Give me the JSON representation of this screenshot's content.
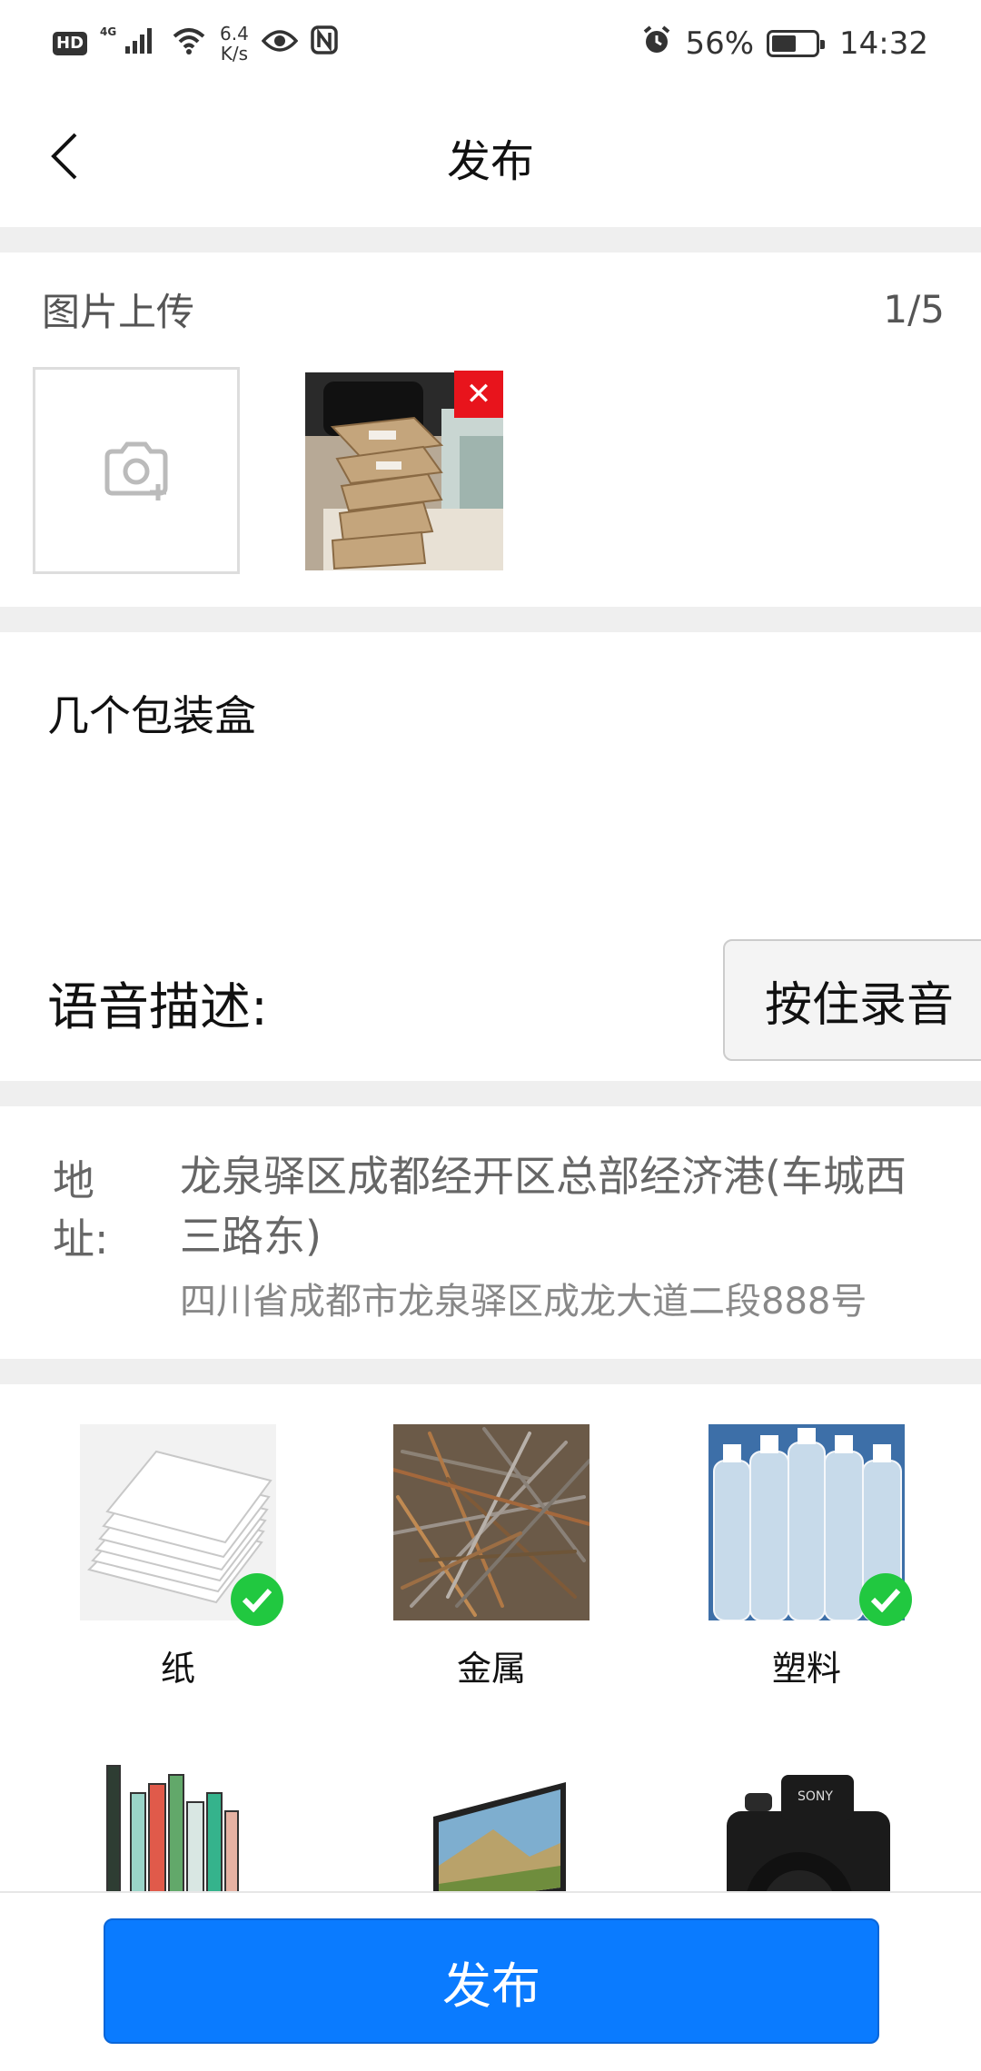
{
  "status_bar": {
    "hd": "HD",
    "network": "4G",
    "speed_value": "6.4",
    "speed_unit": "K/s",
    "battery": "56%",
    "time": "14:32"
  },
  "nav": {
    "title": "发布"
  },
  "upload": {
    "title": "图片上传",
    "count": "1/5"
  },
  "description": {
    "text": "几个包装盒"
  },
  "voice": {
    "label": "语音描述:",
    "button": "按住录音"
  },
  "address": {
    "label_line1": "地",
    "label_line2": "址:",
    "main": "龙泉驿区成都经开区总部经济港(车城西三路东)",
    "sub": "四川省成都市龙泉驿区成龙大道二段888号"
  },
  "categories": [
    {
      "label": "纸",
      "selected": true
    },
    {
      "label": "金属",
      "selected": false
    },
    {
      "label": "塑料",
      "selected": true
    },
    {
      "label": "",
      "selected": false
    },
    {
      "label": "",
      "selected": false
    },
    {
      "label": "",
      "selected": false
    }
  ],
  "bottom": {
    "publish": "发布"
  },
  "colors": {
    "primary": "#0a7bff",
    "check": "#21c840",
    "delete": "#e8141c"
  }
}
